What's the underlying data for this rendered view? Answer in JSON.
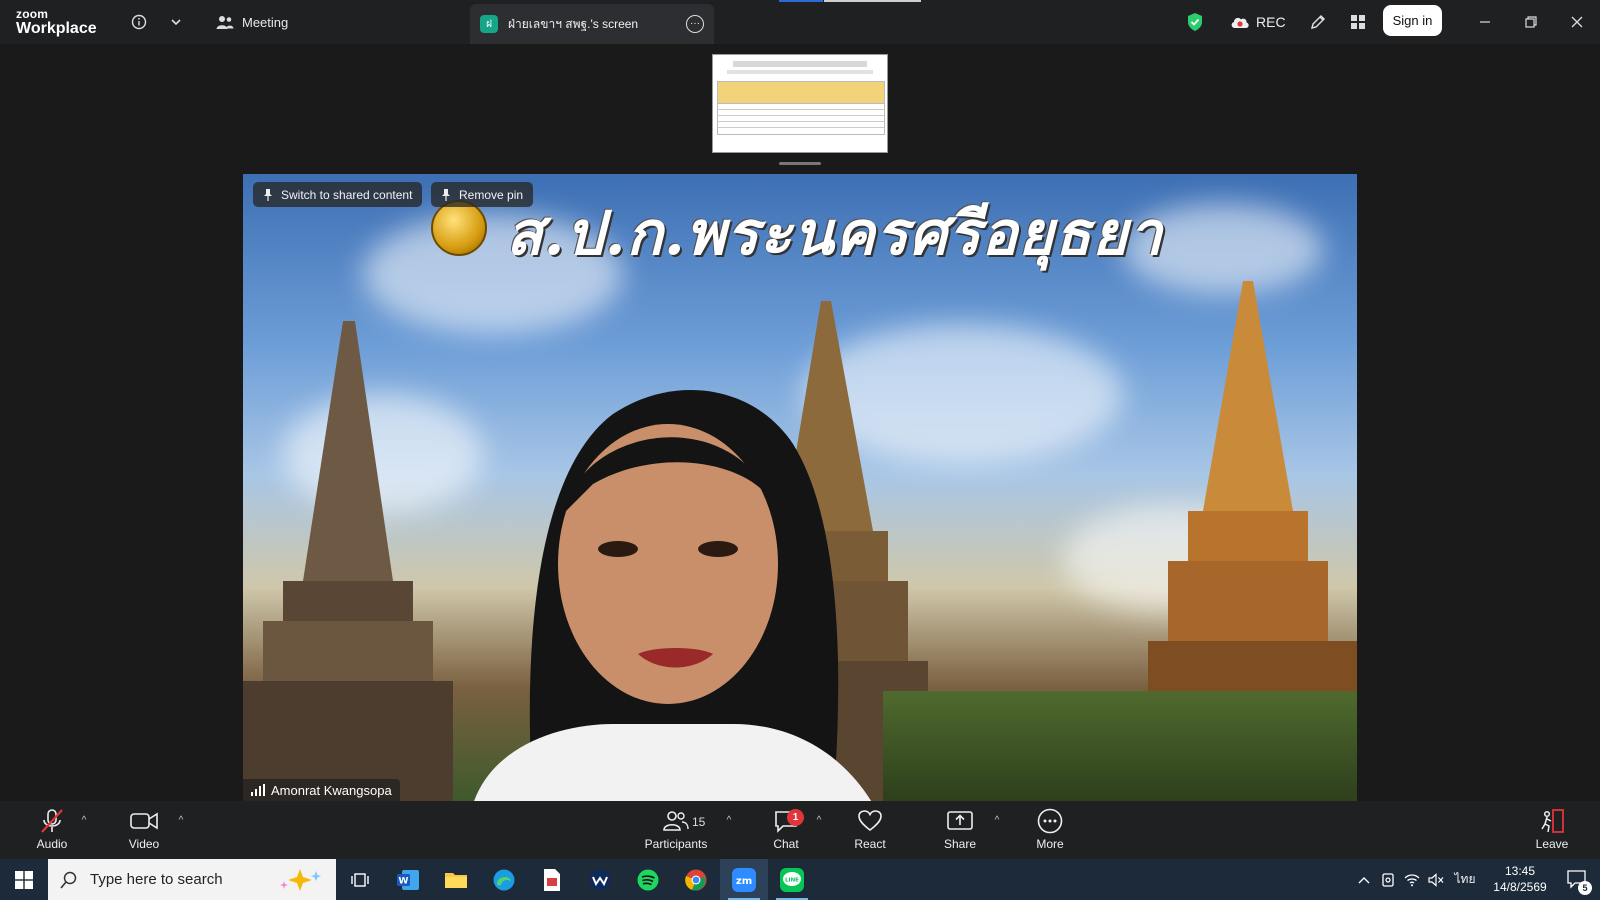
{
  "titlebar": {
    "brand_top": "zoom",
    "brand_bottom": "Workplace",
    "meeting_label": "Meeting",
    "share_tab": {
      "avatar_letter": "ฝ",
      "label": "ฝ่ายเลขาฯ สพฐ.'s screen"
    },
    "rec_label": "REC",
    "signin_label": "Sign in"
  },
  "stage": {
    "video_title": "ส.ป.ก.พระนครศรีอยุธยา",
    "pin_buttons": {
      "switch_label": "Switch to shared content",
      "remove_label": "Remove pin"
    },
    "speaker_name": "Amonrat Kwangsopa"
  },
  "toolbar": {
    "audio": "Audio",
    "video": "Video",
    "participants": "Participants",
    "participants_count": "15",
    "chat": "Chat",
    "chat_badge": "1",
    "react": "React",
    "share": "Share",
    "more": "More",
    "leave": "Leave"
  },
  "taskbar": {
    "search_placeholder": "Type here to search",
    "language": "ไทย",
    "time": "13:45",
    "date": "14/8/2569",
    "notification_count": "5"
  },
  "colors": {
    "accent_green": "#2ecc71",
    "leave_red": "#e0353a",
    "chat_badge": "#e0353a"
  }
}
